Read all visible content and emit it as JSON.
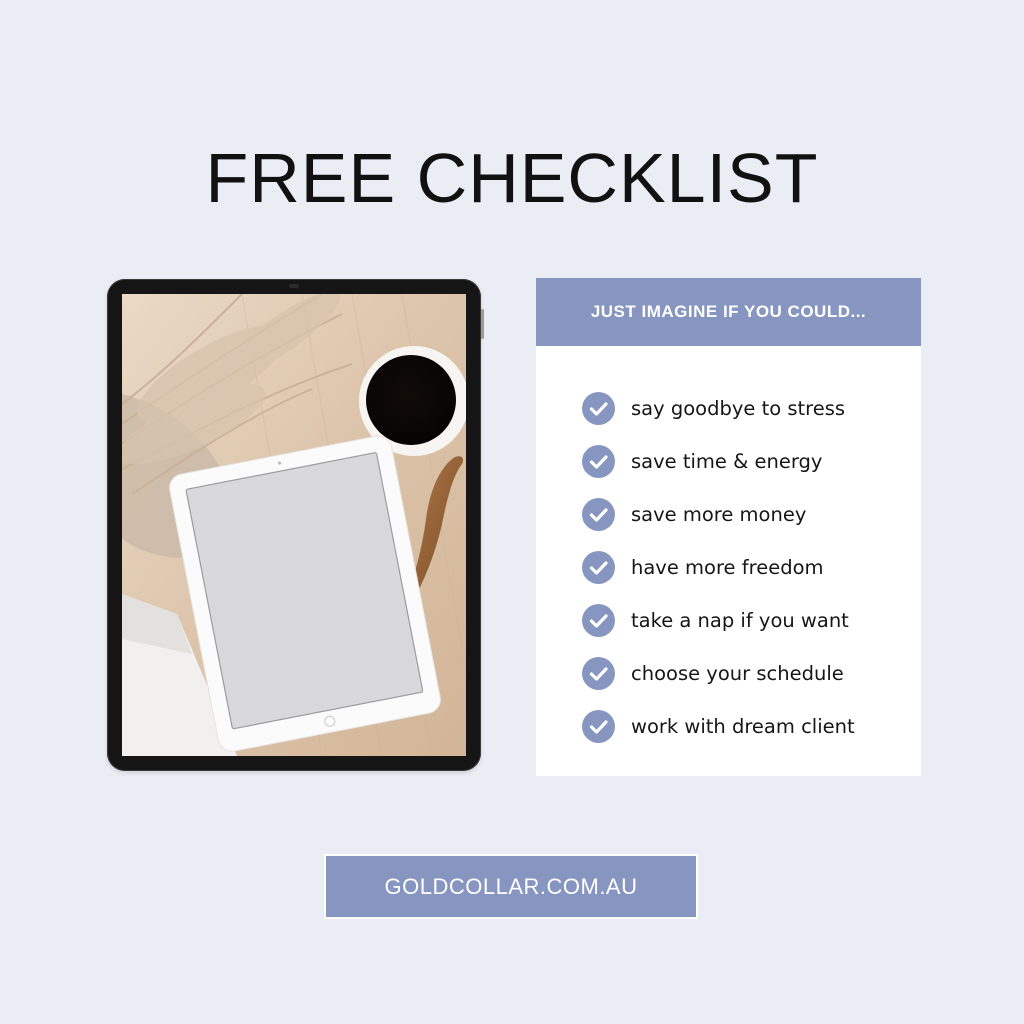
{
  "page": {
    "title": "FREE CHECKLIST"
  },
  "colors": {
    "background": "#eaedf3",
    "accent": "#8796c1",
    "panel": "#ffffff",
    "text": "#161616"
  },
  "mockup": {
    "icon": "tablet-photo",
    "photo_subject": "flatlay-tablet-coffee-pampas"
  },
  "checklist": {
    "header": "JUST IMAGINE IF YOU COULD...",
    "icon": "check-circle-icon",
    "items": [
      {
        "label": "say goodbye to stress"
      },
      {
        "label": "save time & energy"
      },
      {
        "label": "save more money"
      },
      {
        "label": "have more freedom"
      },
      {
        "label": "take a nap if you want"
      },
      {
        "label": "choose your schedule"
      },
      {
        "label": "work with dream client"
      }
    ]
  },
  "cta": {
    "label": "GOLDCOLLAR.COM.AU"
  }
}
